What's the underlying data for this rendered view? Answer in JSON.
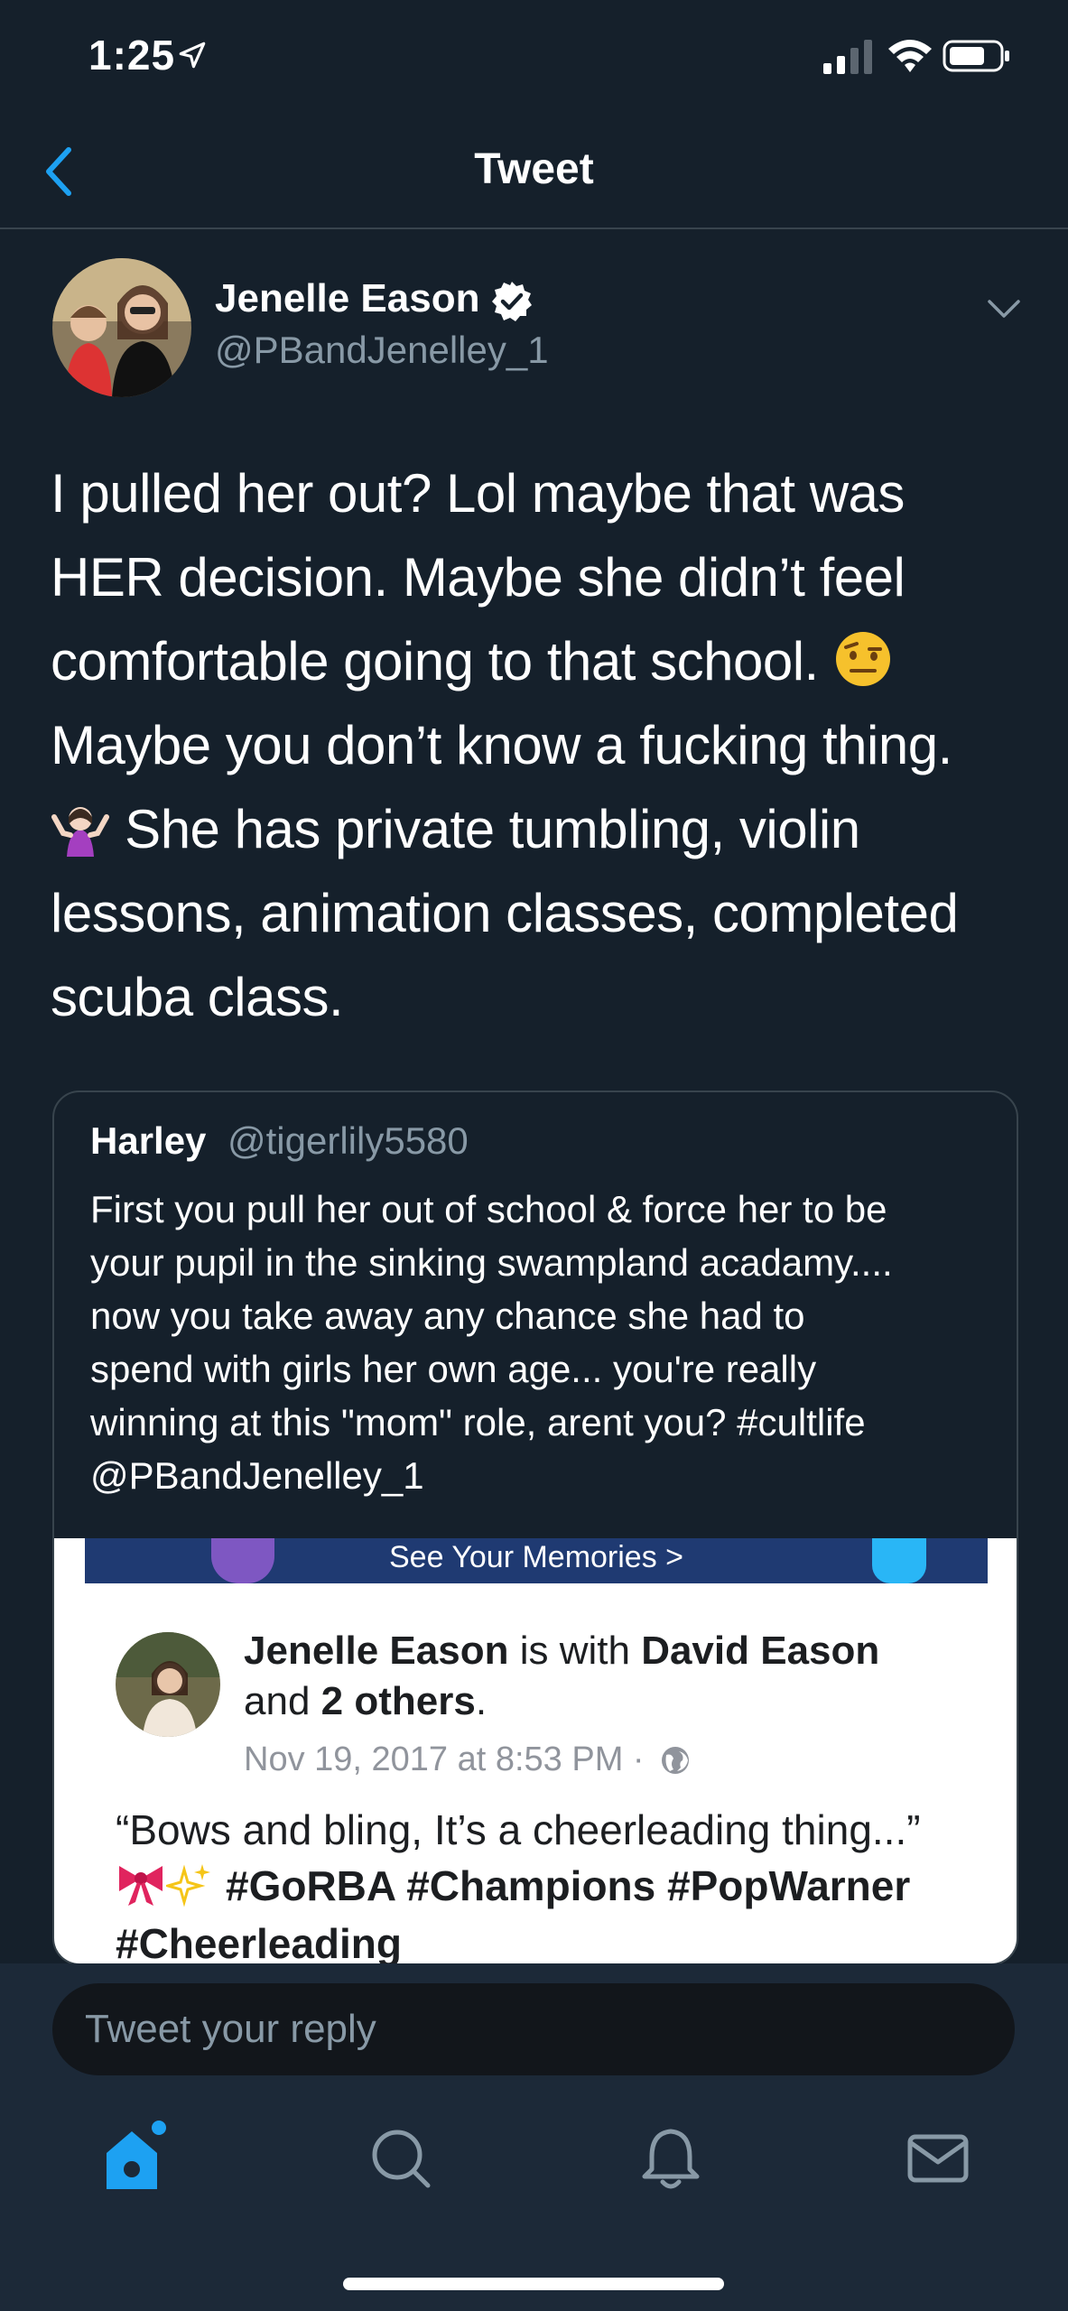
{
  "status_bar": {
    "time": "1:25"
  },
  "nav": {
    "title": "Tweet"
  },
  "tweet": {
    "author_name": "Jenelle Eason",
    "author_handle": "@PBandJenelley_1",
    "text_lines": [
      "I pulled her out? Lol maybe that was",
      "HER decision. Maybe she didn’t feel",
      "comfortable going to that school.",
      "Maybe you don’t know a fucking thing.",
      "She has private tumbling, violin",
      "lessons, animation classes, completed",
      "scuba class."
    ]
  },
  "quote": {
    "name": "Harley",
    "handle": "@tigerlily5580",
    "text_lines": [
      "First you pull her out of school & force her to be",
      "your pupil in the sinking swampland acadamy....",
      "now you take away any chance she had to",
      "spend with girls her own age... you're really",
      "winning at this \"mom\" role, arent you? #cultlife",
      "@PBandJenelley_1"
    ],
    "media": {
      "banner_text": "See Your Memories >",
      "post_author": "Jenelle Eason",
      "with_word": " is with ",
      "tagged": "David Eason",
      "and_word": "and ",
      "others": "2 others",
      "period": ".",
      "date": "Nov 19, 2017 at 8:53 PM ·",
      "caption_line1": "“Bows and bling, It’s a cheerleading thing...”",
      "caption_tags": "#GoRBA #Champions #PopWarner",
      "caption_line3": "#Cheerleading"
    }
  },
  "reply": {
    "placeholder": "Tweet your reply"
  },
  "tabs": [
    {
      "name": "home",
      "icon": "home-icon",
      "active": true
    },
    {
      "name": "search",
      "icon": "search-icon",
      "active": false
    },
    {
      "name": "notifications",
      "icon": "bell-icon",
      "active": false
    },
    {
      "name": "messages",
      "icon": "mail-icon",
      "active": false
    }
  ],
  "colors": {
    "background": "#15202b",
    "accent": "#1da1f2",
    "secondary_text": "#8899a6",
    "divider": "#38444d",
    "reply_bar": "#1c2938"
  }
}
